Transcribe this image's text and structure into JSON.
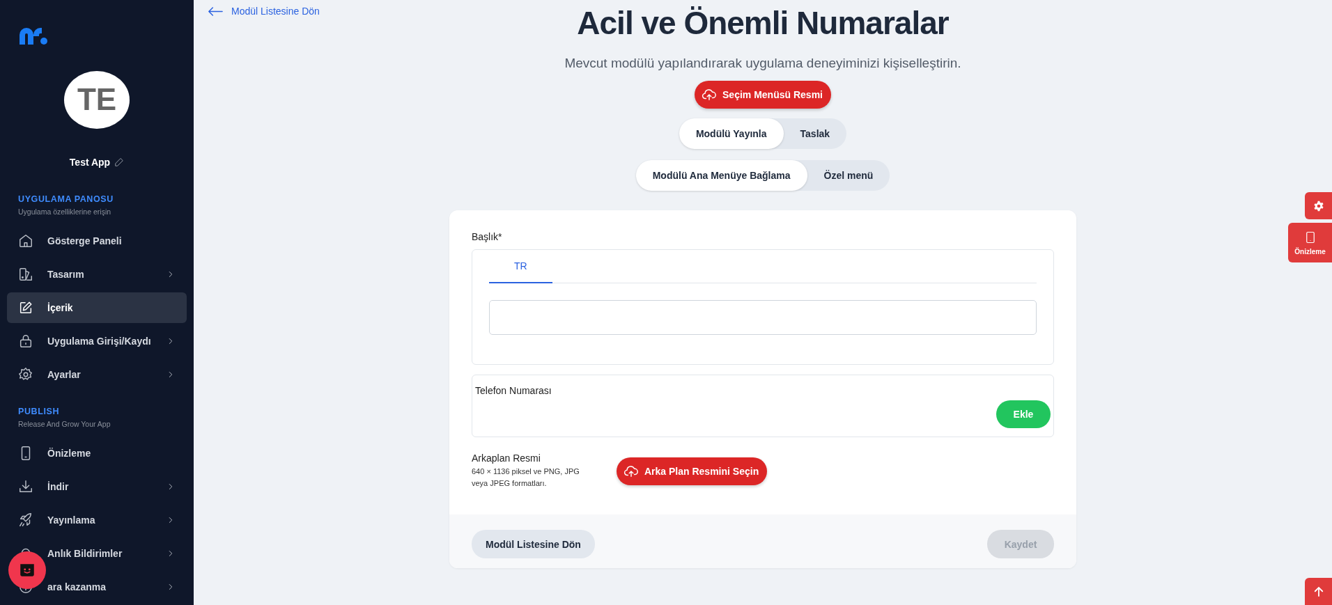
{
  "sidebar": {
    "avatar": {
      "initials": "TE"
    },
    "app_name": "Test App",
    "sections": [
      {
        "title": "UYGULAMA PANOSU",
        "subtitle": "Uygulama özelliklerine erişin",
        "items": [
          {
            "label": "Gösterge Paneli",
            "expandable": false,
            "selected": false
          },
          {
            "label": "Tasarım",
            "expandable": true,
            "selected": false
          },
          {
            "label": "İçerik",
            "expandable": false,
            "selected": true
          },
          {
            "label": "Uygulama Girişi/Kaydı",
            "expandable": true,
            "selected": false
          },
          {
            "label": "Ayarlar",
            "expandable": true,
            "selected": false
          }
        ]
      },
      {
        "title": "PUBLISH",
        "subtitle": "Release And Grow Your App",
        "items": [
          {
            "label": "Önizleme",
            "expandable": false,
            "selected": false
          },
          {
            "label": "İndir",
            "expandable": true,
            "selected": false
          },
          {
            "label": "Yayınlama",
            "expandable": true,
            "selected": false
          },
          {
            "label": "Anlık Bildirimler",
            "expandable": true,
            "selected": false
          },
          {
            "label": "ara kazanma",
            "expandable": true,
            "selected": false
          }
        ]
      }
    ]
  },
  "header": {
    "back_link": "Modül Listesine Dön",
    "title": "Acil ve Önemli Numaralar",
    "subtitle": "Mevcut modülü yapılandırarak uygulama deneyiminizi kişiselleştirin.",
    "image_button": "Seçim Menüsü Resmi"
  },
  "toggles": [
    [
      {
        "label": "Modülü Yayınla",
        "selected": true
      },
      {
        "label": "Taslak",
        "selected": false
      }
    ],
    [
      {
        "label": "Modülü Ana Menüye Bağlama",
        "selected": true
      },
      {
        "label": "Özel menü",
        "selected": false
      }
    ]
  ],
  "form": {
    "title_label": "Başlık*",
    "language_tabs": [
      {
        "label": "TR",
        "selected": true
      }
    ],
    "phone_label": "Telefon Numarası",
    "add_button": "Ekle",
    "background_label": "Arkaplan Resmi",
    "background_hint": "640 × 1136 piksel ve PNG, JPG veya JPEG formatları.",
    "background_button": "Arka Plan Resmini Seçin",
    "back_button": "Modül Listesine Dön",
    "save_button": {
      "label": "Kaydet",
      "disabled": true
    }
  },
  "side_buttons": {
    "preview": "Önizleme"
  }
}
